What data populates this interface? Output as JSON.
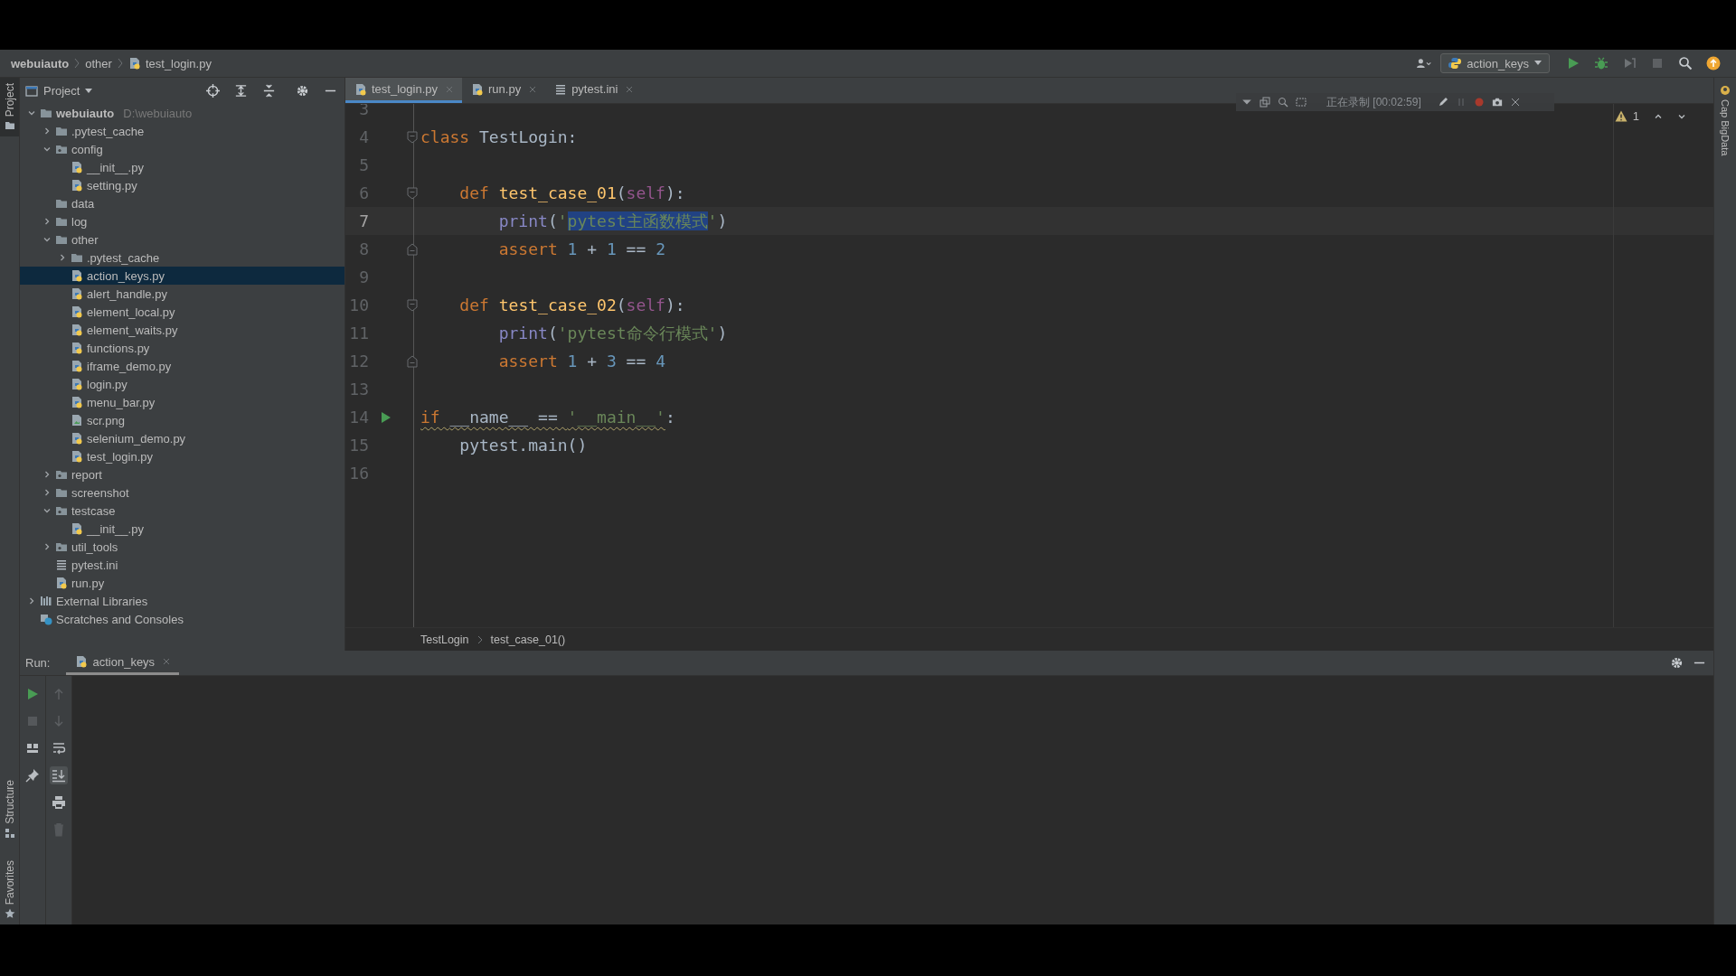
{
  "breadcrumbs": [
    {
      "label": "webuiauto",
      "kind": "module"
    },
    {
      "label": "other",
      "kind": "folder"
    },
    {
      "label": "test_login.py",
      "kind": "python"
    }
  ],
  "run_config": {
    "label": "action_keys"
  },
  "side_tabs": {
    "left_top": [
      {
        "label": "Project",
        "kind": "project",
        "selected": true
      }
    ],
    "left_bottom": [
      {
        "label": "Structure",
        "kind": "structure",
        "selected": false
      },
      {
        "label": "Favorites",
        "kind": "favorites",
        "selected": false
      }
    ],
    "right": [
      {
        "label": "Cap BigData",
        "kind": "plugin",
        "selected": false
      }
    ]
  },
  "project_panel": {
    "title": "Project"
  },
  "tree": [
    {
      "name": "webuiauto",
      "path": "D:\\webuiauto",
      "kind": "module",
      "expanded": true,
      "selected": false,
      "children": [
        {
          "name": ".pytest_cache",
          "kind": "folder",
          "expanded": false,
          "selected": false
        },
        {
          "name": "config",
          "kind": "package",
          "expanded": true,
          "selected": false,
          "children": [
            {
              "name": "__init__.py",
              "kind": "python",
              "selected": false
            },
            {
              "name": "setting.py",
              "kind": "python",
              "selected": false
            }
          ]
        },
        {
          "name": "data",
          "kind": "folder",
          "selected": false
        },
        {
          "name": "log",
          "kind": "folder",
          "expanded": false,
          "selected": false
        },
        {
          "name": "other",
          "kind": "folder",
          "expanded": true,
          "selected": false,
          "children": [
            {
              "name": ".pytest_cache",
              "kind": "folder",
              "expanded": false,
              "selected": false
            },
            {
              "name": "action_keys.py",
              "kind": "python",
              "selected": true
            },
            {
              "name": "alert_handle.py",
              "kind": "python",
              "selected": false
            },
            {
              "name": "element_local.py",
              "kind": "python",
              "selected": false
            },
            {
              "name": "element_waits.py",
              "kind": "python",
              "selected": false
            },
            {
              "name": "functions.py",
              "kind": "python",
              "selected": false
            },
            {
              "name": "iframe_demo.py",
              "kind": "python",
              "selected": false
            },
            {
              "name": "login.py",
              "kind": "python",
              "selected": false
            },
            {
              "name": "menu_bar.py",
              "kind": "python",
              "selected": false
            },
            {
              "name": "scr.png",
              "kind": "image",
              "selected": false
            },
            {
              "name": "selenium_demo.py",
              "kind": "python",
              "selected": false
            },
            {
              "name": "test_login.py",
              "kind": "python",
              "selected": false
            }
          ]
        },
        {
          "name": "report",
          "kind": "package",
          "expanded": false,
          "selected": false
        },
        {
          "name": "screenshot",
          "kind": "folder",
          "expanded": false,
          "selected": false
        },
        {
          "name": "testcase",
          "kind": "package",
          "expanded": true,
          "selected": false,
          "children": [
            {
              "name": "__init__.py",
              "kind": "python",
              "selected": false
            }
          ]
        },
        {
          "name": "util_tools",
          "kind": "package",
          "expanded": false,
          "selected": false
        },
        {
          "name": "pytest.ini",
          "kind": "ini",
          "selected": false
        },
        {
          "name": "run.py",
          "kind": "python",
          "selected": false
        }
      ]
    },
    {
      "name": "External Libraries",
      "kind": "library",
      "expanded": false,
      "selected": false
    },
    {
      "name": "Scratches and Consoles",
      "kind": "scratches",
      "selected": false
    }
  ],
  "editor_tabs": [
    {
      "label": "test_login.py",
      "kind": "python",
      "selected": true
    },
    {
      "label": "run.py",
      "kind": "python",
      "selected": false
    },
    {
      "label": "pytest.ini",
      "kind": "ini",
      "selected": false
    }
  ],
  "recorder": {
    "status": "正在录制 [00:02:59]"
  },
  "warnings": {
    "count": "1"
  },
  "code": [
    {
      "number": "3"
    },
    {
      "number": "4",
      "fold_start": true,
      "tokens": [
        {
          "text": "class ",
          "kind": "keyword"
        },
        {
          "text": "TestLogin:",
          "kind": "plain"
        }
      ]
    },
    {
      "number": "5"
    },
    {
      "number": "6",
      "fold_start": true,
      "tokens": [
        {
          "text": "    def ",
          "kind": "keyword"
        },
        {
          "text": "test_case_01",
          "kind": "function"
        },
        {
          "text": "(",
          "kind": "plain"
        },
        {
          "text": "self",
          "kind": "self"
        },
        {
          "text": "):",
          "kind": "plain"
        }
      ]
    },
    {
      "number": "7",
      "current": true,
      "tokens": [
        {
          "text": "        print",
          "kind": "builtin"
        },
        {
          "text": "(",
          "kind": "plain"
        },
        {
          "text": "'",
          "kind": "string"
        },
        {
          "text": "pytest主函数模式",
          "kind": "string",
          "selected": true
        },
        {
          "text": "'",
          "kind": "string"
        },
        {
          "text": ")",
          "kind": "plain"
        }
      ]
    },
    {
      "number": "8",
      "fold_end": true,
      "tokens": [
        {
          "text": "        assert ",
          "kind": "keyword"
        },
        {
          "text": "1",
          "kind": "number"
        },
        {
          "text": " + ",
          "kind": "plain"
        },
        {
          "text": "1",
          "kind": "number"
        },
        {
          "text": " == ",
          "kind": "plain"
        },
        {
          "text": "2",
          "kind": "number"
        }
      ]
    },
    {
      "number": "9"
    },
    {
      "number": "10",
      "fold_start": true,
      "tokens": [
        {
          "text": "    def ",
          "kind": "keyword"
        },
        {
          "text": "test_case_02",
          "kind": "function"
        },
        {
          "text": "(",
          "kind": "plain"
        },
        {
          "text": "self",
          "kind": "self"
        },
        {
          "text": "):",
          "kind": "plain"
        }
      ]
    },
    {
      "number": "11",
      "tokens": [
        {
          "text": "        print",
          "kind": "builtin"
        },
        {
          "text": "(",
          "kind": "plain"
        },
        {
          "text": "'pytest命令行模式'",
          "kind": "string"
        },
        {
          "text": ")",
          "kind": "plain"
        }
      ]
    },
    {
      "number": "12",
      "fold_end": true,
      "tokens": [
        {
          "text": "        assert ",
          "kind": "keyword"
        },
        {
          "text": "1",
          "kind": "number"
        },
        {
          "text": " + ",
          "kind": "plain"
        },
        {
          "text": "3",
          "kind": "number"
        },
        {
          "text": " == ",
          "kind": "plain"
        },
        {
          "text": "4",
          "kind": "number"
        }
      ]
    },
    {
      "number": "13"
    },
    {
      "number": "14",
      "run": true,
      "tokens": [
        {
          "text": "if ",
          "kind": "keyword",
          "underlined": true
        },
        {
          "text": "__name__ == ",
          "kind": "plain",
          "underlined": true
        },
        {
          "text": "'__main__'",
          "kind": "string",
          "underlined": true
        },
        {
          "text": ":",
          "kind": "plain"
        }
      ]
    },
    {
      "number": "15",
      "tokens": [
        {
          "text": "    pytest.main()",
          "kind": "plain"
        }
      ]
    },
    {
      "number": "16"
    }
  ],
  "code_breadcrumbs": [
    "TestLogin",
    "test_case_01()"
  ],
  "run_panel": {
    "label": "Run:",
    "tabs": [
      {
        "label": "action_keys",
        "kind": "python",
        "selected": true
      }
    ],
    "scroll_to_end": true
  }
}
